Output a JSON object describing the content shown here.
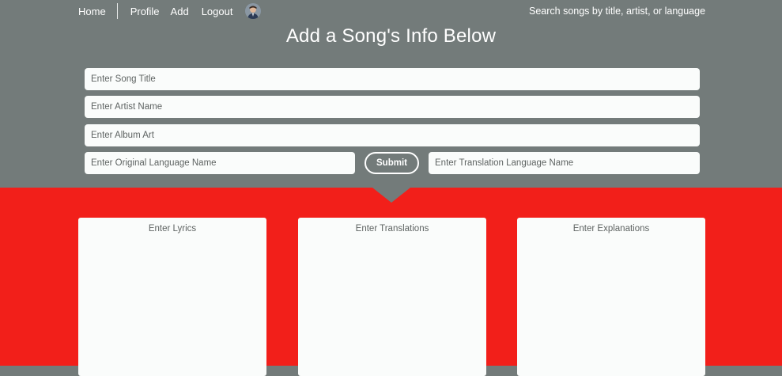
{
  "nav": {
    "home": "Home",
    "profile": "Profile",
    "add": "Add",
    "logout": "Logout",
    "search": "Search songs by title, artist, or language"
  },
  "page": {
    "title": "Add a Song's Info Below"
  },
  "form": {
    "title_placeholder": "Enter Song Title",
    "artist_placeholder": "Enter Artist Name",
    "album_placeholder": "Enter Album Art",
    "original_language_placeholder": "Enter Original Language Name",
    "translation_language_placeholder": "Enter Translation Language Name",
    "submit_label": "Submit"
  },
  "cards": {
    "lyrics": "Enter Lyrics",
    "translations": "Enter Translations",
    "explanations": "Enter Explanations"
  },
  "colors": {
    "header_bg": "#737b7a",
    "accent_red": "#f21f1a",
    "card_bg": "#fafcfb"
  }
}
